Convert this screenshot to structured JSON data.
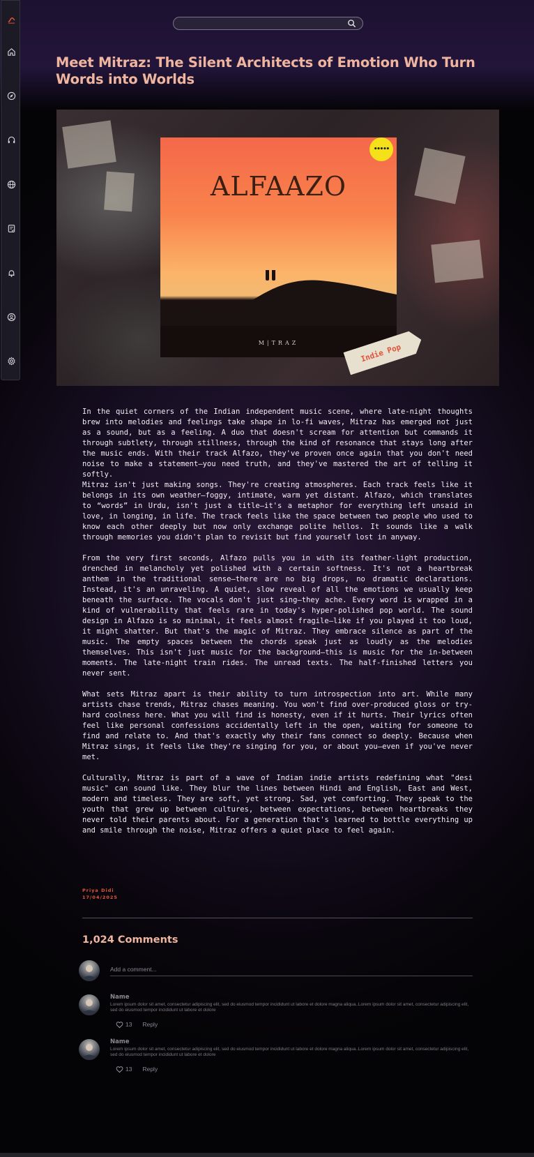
{
  "search": {
    "placeholder": "",
    "value": ""
  },
  "sidebar": {
    "items": [
      {
        "icon": "brand-logo-icon"
      },
      {
        "icon": "home-icon"
      },
      {
        "icon": "compass-icon"
      },
      {
        "icon": "headphones-icon"
      },
      {
        "icon": "globe-icon"
      },
      {
        "icon": "saved-list-icon"
      },
      {
        "icon": "bell-icon"
      },
      {
        "icon": "profile-icon"
      },
      {
        "icon": "settings-icon"
      }
    ]
  },
  "article": {
    "title": "Meet Mitraz: The Silent Architects of Emotion Who Turn Words into Worlds",
    "hero": {
      "album_title": "ALFAAZO",
      "album_artist": "M|TRAZ",
      "sticker": "•••••",
      "genre_tag": "Indie Pop"
    },
    "paragraphs": [
      "In the quiet corners of the Indian independent music scene, where late-night thoughts brew into melodies and feelings take shape in lo-fi waves, Mitraz has emerged not just as a sound, but as a feeling. A duo that doesn't scream for attention but commands it through subtlety, through stillness, through the kind of resonance that stays long after the music ends. With their track Alfazo, they've proven once again that you don't need noise to make a statement—you need truth, and they've mastered the art of telling it softly.",
      "Mitraz isn't just making songs. They're creating atmospheres. Each track feels like it belongs in its own weather—foggy, intimate, warm yet distant. Alfazo, which translates to “words” in Urdu, isn't just a title—it's a metaphor for everything left unsaid in love, in longing, in life. The track feels like the space between two people who used to know each other deeply but now only exchange polite hellos. It sounds like a walk through memories you didn't plan to revisit but find yourself lost in anyway.",
      "From the very first seconds, Alfazo pulls you in with its feather-light production, drenched in melancholy yet polished with a certain softness. It's not a heartbreak anthem in the traditional sense—there are no big drops, no dramatic declarations. Instead, it's an unraveling. A quiet, slow reveal of all the emotions we usually keep beneath the surface. The vocals don't just sing—they ache. Every word is wrapped in a kind of vulnerability that feels rare in today's hyper-polished pop world. The sound design in Alfazo is so minimal, it feels almost fragile—like if you played it too loud, it might shatter. But that's the magic of Mitraz. They embrace silence as part of the music. The empty spaces between the chords speak just as loudly as the melodies themselves. This isn't just music for the background—this is music for the in-between moments. The late-night train rides. The unread texts. The half-finished letters you never sent.",
      "What sets Mitraz apart is their ability to turn introspection into art. While many artists chase trends, Mitraz chases meaning. You won't find over-produced gloss or try-hard coolness here. What you will find is honesty, even if it hurts. Their lyrics often feel like personal confessions accidentally left in the open, waiting for someone to find and relate to. And that's exactly why their fans connect so deeply. Because when Mitraz sings, it feels like they're singing for you, or about you—even if you've never met.",
      "Culturally, Mitraz is part of a wave of Indian indie artists redefining what \"desi music\" can sound like. They blur the lines between Hindi and English, East and West, modern and timeless. They are soft, yet strong. Sad, yet comforting. They speak to the youth that grew up between cultures, between expectations, between heartbreaks they never told their parents about. For a generation that's learned to bottle everything up and smile through the noise, Mitraz offers a quiet place to feel again."
    ],
    "author": "Priya Didi",
    "date": "17/04/2025"
  },
  "comments": {
    "title": "1,024 Comments",
    "input_placeholder": "Add a comment...",
    "items": [
      {
        "name": "Name",
        "text": "Lorem ipsum dolor sit amet, consectetur adipiscing elit, sed do eiusmod tempor incididunt ut labore et dolore magna aliqua..Lorem ipsum dolor sit amet, consectetur adipiscing elit, sed do eiusmod tempor incididunt ut labore et dolore",
        "likes": "13",
        "reply_label": "Reply"
      },
      {
        "name": "Name",
        "text": "Lorem ipsum dolor sit amet, consectetur adipiscing elit, sed do eiusmod tempor incididunt ut labore et dolore magna aliqua..Lorem ipsum dolor sit amet, consectetur adipiscing elit, sed do eiusmod tempor incididunt ut labore et dolore",
        "likes": "13",
        "reply_label": "Reply"
      }
    ]
  },
  "colors": {
    "accent": "#f0b59f",
    "byline": "#e0573a",
    "background": "#0a060e"
  }
}
